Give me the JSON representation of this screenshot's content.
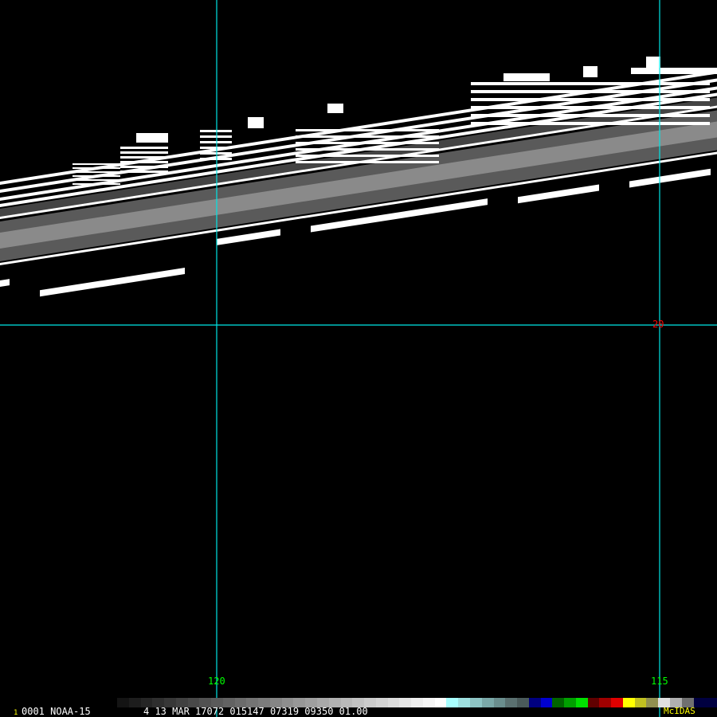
{
  "image": {
    "satellite_line": "0001 NOAA-15",
    "frame_number": "1",
    "info_line": "4 13 MAR 17072 015147 07319 09350 01.00",
    "brand": "McIDAS"
  },
  "grid_labels": {
    "lat_20": "20",
    "lon_120": "120",
    "lon_115": "115"
  },
  "colors": {
    "grid": "#00e5e5",
    "lon_label": "#00ff00",
    "lat_label": "#ff0000",
    "brand": "#ffff00",
    "text": "#ffffff"
  }
}
